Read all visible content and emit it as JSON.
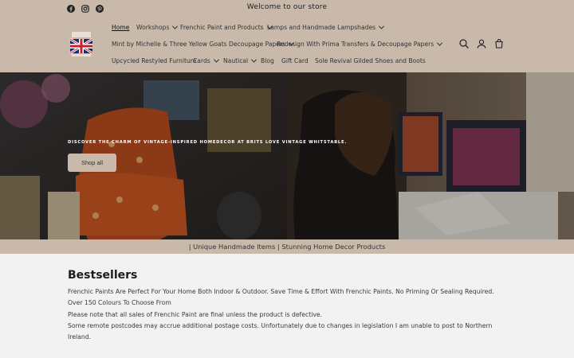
{
  "announcement": {
    "text": "Welcome to our store"
  },
  "social": [
    {
      "name": "facebook-icon"
    },
    {
      "name": "instagram-icon"
    },
    {
      "name": "pinterest-icon"
    }
  ],
  "nav": {
    "home": "Home",
    "workshops": "Workshops",
    "frenchic": "Frenchic Paint and Products",
    "lamps": "Lamps and Handmade Lampshades",
    "mint": "Mint by Michelle & Three Yellow Goats Decoupage Papers",
    "redesign": "Redesign With Prima Transfers & Decoupage Papers",
    "upcycled": "Upcycled Restyled Furniture",
    "cards": "Cards",
    "nautical": "Nautical",
    "blog": "Blog",
    "giftcard": "Gift Card",
    "sole": "Sole Revival Gilded Shoes and Boots"
  },
  "header_icons": [
    "search-icon",
    "account-icon",
    "cart-icon"
  ],
  "hero": {
    "tagline": "DISCOVER THE CHARM OF VINTAGE-INSPIRED HOMEDECOR AT BRITS LOVE VINTAGE WHITSTABLE.",
    "button": "Shop all"
  },
  "strip": {
    "text": "| Unique Handmade Items | Stunning Home Decor Products"
  },
  "main": {
    "title": "Bestsellers",
    "lines": [
      "Frenchic Paints Are Perfect For Your Home Both Indoor & Outdoor. Save Time & Effort With Frenchic Paints. No Priming Or Sealing Required. Over 150 Colours To Choose From",
      "Please note that all sales of Frenchic Paint are final unless the product is defective.",
      "Some remote postcodes may accrue additional postage costs. Unfortunately due to changes in legislation I am unable to post to Northern Ireland."
    ]
  },
  "colors": {
    "brand": "#c9b9aa",
    "page_bg": "#f3f2f2",
    "text": "#222222"
  }
}
